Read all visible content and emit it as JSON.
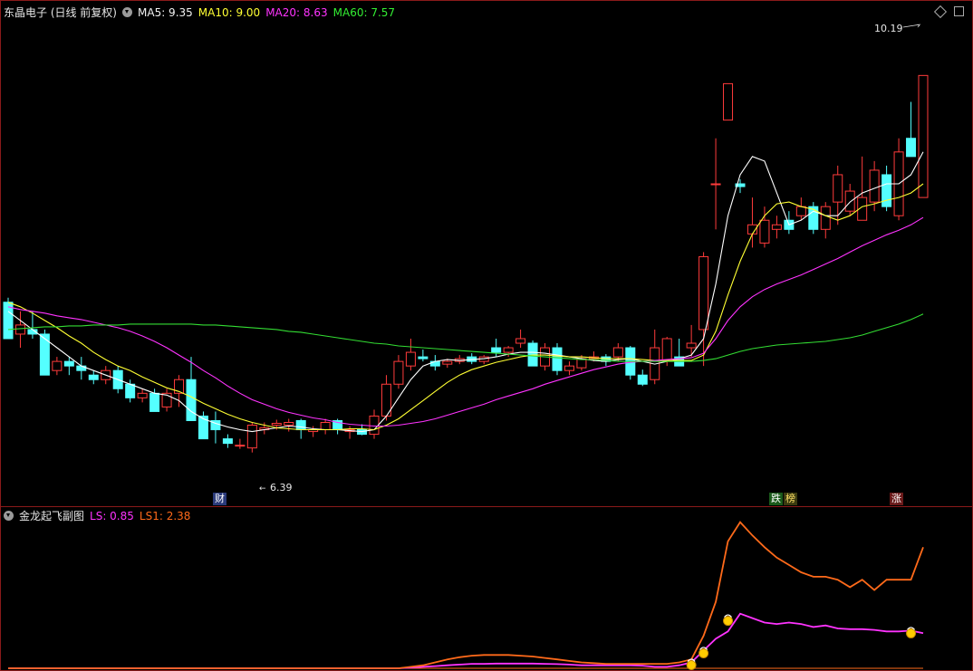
{
  "main_header": {
    "title": "东晶电子 (日线 前复权)",
    "ma5": "MA5: 9.35",
    "ma10": "MA10: 9.00",
    "ma20": "MA20: 8.63",
    "ma60": "MA60: 7.57"
  },
  "sub_header": {
    "title": "金龙起飞副图",
    "ls": "LS: 0.85",
    "ls1": "LS1: 2.38"
  },
  "tags": {
    "cai": "财",
    "die": "跌",
    "bang": "榜",
    "zhang": "涨"
  },
  "colors": {
    "up": "#ff3b3b",
    "down": "#54ffff",
    "ma5": "#ffffff",
    "ma10": "#ffff33",
    "ma20": "#ff33ff",
    "ma60": "#33dd33",
    "ls": "#ff33ff",
    "ls1": "#ff6a1a"
  },
  "chart_data": [
    {
      "type": "candlestick",
      "ylim": [
        5.5,
        10.8
      ],
      "annotations": [
        {
          "label": "10.19",
          "type": "high"
        },
        {
          "label": "6.39",
          "type": "low"
        }
      ],
      "candles": [
        [
          7.7,
          7.3,
          7.75,
          7.3
        ],
        [
          7.35,
          7.45,
          7.6,
          7.2
        ],
        [
          7.4,
          7.35,
          7.6,
          7.3
        ],
        [
          7.35,
          6.9,
          7.4,
          6.9
        ],
        [
          6.95,
          7.05,
          7.1,
          6.9
        ],
        [
          7.05,
          7.0,
          7.1,
          6.9
        ],
        [
          7.0,
          6.95,
          7.1,
          6.85
        ],
        [
          6.9,
          6.85,
          6.95,
          6.8
        ],
        [
          6.85,
          6.95,
          7.0,
          6.8
        ],
        [
          6.95,
          6.75,
          7.0,
          6.7
        ],
        [
          6.8,
          6.65,
          6.85,
          6.6
        ],
        [
          6.65,
          6.7,
          6.75,
          6.6
        ],
        [
          6.7,
          6.5,
          6.75,
          6.5
        ],
        [
          6.55,
          6.7,
          6.75,
          6.5
        ],
        [
          6.7,
          6.85,
          6.9,
          6.55
        ],
        [
          6.85,
          6.4,
          7.1,
          6.4
        ],
        [
          6.45,
          6.2,
          6.5,
          6.2
        ],
        [
          6.4,
          6.3,
          6.5,
          6.15
        ],
        [
          6.2,
          6.15,
          6.25,
          6.1
        ],
        [
          6.12,
          6.13,
          6.2,
          6.09
        ],
        [
          6.1,
          6.35,
          6.38,
          6.05
        ],
        [
          6.3,
          6.32,
          6.38,
          6.25
        ],
        [
          6.35,
          6.37,
          6.41,
          6.3
        ],
        [
          6.35,
          6.38,
          6.42,
          6.28
        ],
        [
          6.4,
          6.3,
          6.42,
          6.2
        ],
        [
          6.28,
          6.3,
          6.34,
          6.22
        ],
        [
          6.3,
          6.38,
          6.42,
          6.25
        ],
        [
          6.4,
          6.3,
          6.42,
          6.25
        ],
        [
          6.28,
          6.3,
          6.34,
          6.2
        ],
        [
          6.3,
          6.25,
          6.36,
          6.24
        ],
        [
          6.25,
          6.45,
          6.52,
          6.2
        ],
        [
          6.45,
          6.8,
          6.9,
          6.4
        ],
        [
          6.8,
          7.05,
          7.12,
          6.75
        ],
        [
          7.0,
          7.15,
          7.3,
          6.95
        ],
        [
          7.1,
          7.08,
          7.18,
          7.05
        ],
        [
          7.05,
          7.0,
          7.12,
          6.95
        ],
        [
          7.02,
          7.05,
          7.08,
          6.98
        ],
        [
          7.05,
          7.08,
          7.12,
          7.02
        ],
        [
          7.1,
          7.05,
          7.14,
          7.02
        ],
        [
          7.05,
          7.1,
          7.12,
          7.02
        ],
        [
          7.2,
          7.15,
          7.3,
          7.1
        ],
        [
          7.15,
          7.2,
          7.22,
          7.1
        ],
        [
          7.25,
          7.3,
          7.4,
          7.2
        ],
        [
          7.25,
          7.0,
          7.28,
          7.0
        ],
        [
          7.0,
          7.2,
          7.25,
          6.95
        ],
        [
          7.2,
          6.95,
          7.25,
          6.9
        ],
        [
          6.95,
          7.0,
          7.05,
          6.9
        ],
        [
          6.98,
          7.08,
          7.12,
          6.95
        ],
        [
          7.08,
          7.1,
          7.16,
          7.05
        ],
        [
          7.1,
          7.05,
          7.13,
          7.0
        ],
        [
          7.1,
          7.2,
          7.25,
          7.05
        ],
        [
          7.2,
          6.9,
          7.22,
          6.85
        ],
        [
          6.9,
          6.8,
          6.96,
          6.78
        ],
        [
          6.85,
          7.2,
          7.4,
          6.8
        ],
        [
          7.05,
          7.3,
          7.32,
          7.0
        ],
        [
          7.1,
          7.0,
          7.3,
          7.0
        ],
        [
          7.2,
          7.25,
          7.45,
          7.1
        ],
        [
          7.4,
          8.2,
          8.25,
          7.0
        ],
        [
          9.0,
          9.0,
          9.5,
          8.5
        ],
        [
          9.7,
          10.1,
          10.1,
          9.7
        ],
        [
          9.0,
          8.97,
          9.05,
          8.9
        ],
        [
          8.45,
          8.55,
          8.85,
          8.3
        ],
        [
          8.35,
          8.6,
          8.75,
          8.3
        ],
        [
          8.5,
          8.55,
          8.65,
          8.4
        ],
        [
          8.6,
          8.5,
          8.7,
          8.45
        ],
        [
          8.65,
          8.75,
          8.85,
          8.6
        ],
        [
          8.75,
          8.5,
          8.8,
          8.45
        ],
        [
          8.5,
          8.75,
          8.8,
          8.4
        ],
        [
          8.8,
          9.1,
          9.2,
          8.55
        ],
        [
          8.7,
          8.92,
          9.0,
          8.65
        ],
        [
          8.6,
          8.85,
          9.3,
          8.6
        ],
        [
          8.8,
          9.15,
          9.25,
          8.7
        ],
        [
          9.1,
          8.75,
          9.2,
          8.7
        ],
        [
          8.65,
          9.35,
          9.5,
          8.6
        ],
        [
          9.5,
          9.3,
          9.9,
          9.3
        ],
        [
          8.85,
          10.19,
          10.19,
          8.85
        ]
      ],
      "series": [
        {
          "name": "MA5",
          "values": [
            7.6,
            7.5,
            7.4,
            7.3,
            7.2,
            7.1,
            7.0,
            6.95,
            6.9,
            6.85,
            6.8,
            6.75,
            6.7,
            6.68,
            6.62,
            6.5,
            6.42,
            6.37,
            6.33,
            6.3,
            6.28,
            6.3,
            6.32,
            6.34,
            6.33,
            6.31,
            6.3,
            6.3,
            6.29,
            6.28,
            6.3,
            6.45,
            6.65,
            6.85,
            7.0,
            7.05,
            7.07,
            7.06,
            7.07,
            7.08,
            7.1,
            7.13,
            7.15,
            7.15,
            7.14,
            7.12,
            7.1,
            7.08,
            7.06,
            7.05,
            7.07,
            7.08,
            7.05,
            7.02,
            7.05,
            7.08,
            7.12,
            7.3,
            7.9,
            8.65,
            9.1,
            9.3,
            9.25,
            8.9,
            8.55,
            8.6,
            8.7,
            8.65,
            8.65,
            8.8,
            8.9,
            8.95,
            9.0,
            9.0,
            9.1,
            9.35
          ]
        },
        {
          "name": "MA10",
          "values": [
            7.7,
            7.65,
            7.58,
            7.5,
            7.42,
            7.33,
            7.25,
            7.15,
            7.07,
            7.0,
            6.95,
            6.88,
            6.82,
            6.76,
            6.72,
            6.66,
            6.59,
            6.53,
            6.47,
            6.42,
            6.38,
            6.35,
            6.32,
            6.31,
            6.3,
            6.3,
            6.3,
            6.3,
            6.31,
            6.31,
            6.3,
            6.35,
            6.42,
            6.52,
            6.62,
            6.72,
            6.82,
            6.9,
            6.96,
            7.0,
            7.04,
            7.07,
            7.1,
            7.12,
            7.12,
            7.11,
            7.1,
            7.1,
            7.09,
            7.08,
            7.08,
            7.08,
            7.07,
            7.06,
            7.06,
            7.06,
            7.06,
            7.12,
            7.38,
            7.78,
            8.15,
            8.45,
            8.65,
            8.78,
            8.8,
            8.75,
            8.72,
            8.65,
            8.6,
            8.65,
            8.75,
            8.78,
            8.82,
            8.85,
            8.9,
            9.0
          ]
        },
        {
          "name": "MA20",
          "values": [
            7.65,
            7.62,
            7.6,
            7.58,
            7.55,
            7.53,
            7.51,
            7.48,
            7.45,
            7.42,
            7.38,
            7.33,
            7.27,
            7.2,
            7.12,
            7.04,
            6.95,
            6.87,
            6.78,
            6.7,
            6.63,
            6.58,
            6.53,
            6.49,
            6.46,
            6.43,
            6.41,
            6.38,
            6.36,
            6.35,
            6.34,
            6.34,
            6.35,
            6.37,
            6.39,
            6.42,
            6.46,
            6.5,
            6.54,
            6.58,
            6.63,
            6.67,
            6.71,
            6.75,
            6.8,
            6.84,
            6.88,
            6.92,
            6.96,
            6.99,
            7.02,
            7.04,
            7.05,
            7.06,
            7.07,
            7.08,
            7.09,
            7.14,
            7.3,
            7.5,
            7.65,
            7.76,
            7.84,
            7.9,
            7.95,
            8.0,
            8.06,
            8.12,
            8.18,
            8.25,
            8.32,
            8.38,
            8.44,
            8.49,
            8.55,
            8.63
          ]
        },
        {
          "name": "MA60",
          "values": [
            7.4,
            7.41,
            7.42,
            7.43,
            7.43,
            7.44,
            7.44,
            7.45,
            7.45,
            7.45,
            7.46,
            7.46,
            7.46,
            7.46,
            7.46,
            7.46,
            7.45,
            7.45,
            7.44,
            7.43,
            7.42,
            7.41,
            7.4,
            7.38,
            7.37,
            7.35,
            7.33,
            7.31,
            7.29,
            7.27,
            7.25,
            7.24,
            7.22,
            7.21,
            7.2,
            7.19,
            7.18,
            7.17,
            7.16,
            7.15,
            7.14,
            7.13,
            7.12,
            7.11,
            7.1,
            7.09,
            7.08,
            7.07,
            7.07,
            7.06,
            7.05,
            7.05,
            7.05,
            7.05,
            7.05,
            7.05,
            7.05,
            7.06,
            7.08,
            7.12,
            7.16,
            7.19,
            7.21,
            7.23,
            7.24,
            7.25,
            7.26,
            7.27,
            7.29,
            7.31,
            7.34,
            7.38,
            7.42,
            7.46,
            7.51,
            7.57
          ]
        }
      ]
    },
    {
      "type": "line",
      "ylim": [
        0,
        10
      ],
      "series": [
        {
          "name": "LS",
          "values": [
            0,
            0,
            0,
            0,
            0,
            0,
            0,
            0,
            0,
            0,
            0,
            0,
            0,
            0,
            0,
            0,
            0,
            0,
            0,
            0,
            0,
            0,
            0,
            0,
            0,
            0,
            0,
            0,
            0,
            0,
            0,
            0,
            0,
            0.05,
            0.1,
            0.15,
            0.2,
            0.25,
            0.3,
            0.3,
            0.32,
            0.32,
            0.32,
            0.32,
            0.3,
            0.28,
            0.25,
            0.2,
            0.2,
            0.2,
            0.2,
            0.2,
            0.18,
            0.1,
            0.1,
            0.2,
            0.4,
            1.2,
            2.0,
            2.5,
            3.7,
            3.4,
            3.1,
            3.0,
            3.1,
            3.0,
            2.8,
            2.9,
            2.7,
            2.65,
            2.65,
            2.6,
            2.5,
            2.5,
            2.55,
            2.38
          ]
        },
        {
          "name": "LS1",
          "values": [
            0,
            0,
            0,
            0,
            0,
            0,
            0,
            0,
            0,
            0,
            0,
            0,
            0,
            0,
            0,
            0,
            0,
            0,
            0,
            0,
            0,
            0,
            0,
            0,
            0,
            0,
            0,
            0,
            0,
            0,
            0,
            0,
            0,
            0.1,
            0.2,
            0.4,
            0.6,
            0.75,
            0.85,
            0.9,
            0.9,
            0.9,
            0.85,
            0.8,
            0.7,
            0.6,
            0.5,
            0.4,
            0.35,
            0.3,
            0.3,
            0.3,
            0.3,
            0.3,
            0.3,
            0.4,
            0.6,
            2.2,
            4.5,
            8.6,
            9.9,
            9.0,
            8.2,
            7.5,
            7.0,
            6.5,
            6.2,
            6.2,
            6.0,
            5.5,
            6.0,
            5.3,
            6.0,
            6.0,
            6.0,
            8.2
          ]
        }
      ],
      "markers": [
        {
          "index": 56,
          "value": 0.4
        },
        {
          "index": 57,
          "value": 1.2
        },
        {
          "index": 59,
          "value": 3.4
        },
        {
          "index": 74,
          "value": 2.55
        }
      ]
    }
  ]
}
